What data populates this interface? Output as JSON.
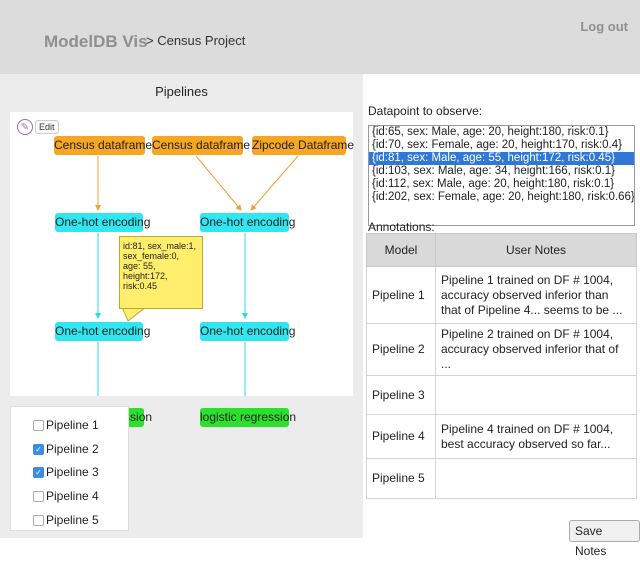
{
  "header": {
    "brand": "ModelDB Vis",
    "breadcrumb": "> Census Project",
    "logout": "Log out"
  },
  "left": {
    "title": "Pipelines",
    "edit_label": "Edit",
    "nodes": {
      "p1_source": "Census dataframe",
      "p2_source_a": "Census dataframe",
      "p2_source_b": "Zipcode Dataframe",
      "p1_enc1": "One-hot encoding",
      "p2_enc1": "One-hot encoding",
      "p1_enc2": "One-hot encoding",
      "p2_enc2": "One-hot encoding",
      "p1_lr": "logistic regression",
      "p2_lr": "logistic regression"
    },
    "tooltip_lines": [
      "id:81, sex_male:1,",
      "sex_female:0,",
      "age: 55, height:172,",
      "risk:0.45"
    ],
    "pipelines": [
      {
        "label": "Pipeline 1",
        "checked": false
      },
      {
        "label": "Pipeline 2",
        "checked": true
      },
      {
        "label": "Pipeline 3",
        "checked": true
      },
      {
        "label": "Pipeline 4",
        "checked": false
      },
      {
        "label": "Pipeline 5",
        "checked": false
      }
    ]
  },
  "colors": {
    "source_node": "#f5a623",
    "encoding_node": "#30e6f0",
    "model_node": "#2ce12c",
    "tooltip": "#ffee6b",
    "selection": "#2f78d8"
  },
  "datapoints": {
    "label": "Datapoint to observe:",
    "options": [
      "{id:65, sex: Male, age: 20, height:180, risk:0.1}",
      "{id:70, sex: Female, age: 20, height:170, risk:0.4}",
      "{id:81, sex: Male, age: 55, height:172, risk:0.45}",
      "{id:103, sex: Male, age: 34, height:166, risk:0.1}",
      "{id:112, sex: Male, age: 20, height:180, risk:0.1}",
      "{id:202, sex: Female, age: 20, height:180, risk:0.66}"
    ],
    "selected_index": 2
  },
  "annotations": {
    "label": "Annotations:",
    "headers": [
      "Model",
      "User Notes"
    ],
    "rows": [
      {
        "model": "Pipeline 1",
        "note": "Pipeline 1 trained on DF # 1004, accuracy observed inferior than that of Pipeline 4... seems to be ..."
      },
      {
        "model": "Pipeline 2",
        "note": "Pipeline 2 trained on DF # 1004, accuracy observed inferior that of ..."
      },
      {
        "model": "Pipeline 3",
        "note": ""
      },
      {
        "model": "Pipeline 4",
        "note": "Pipeline 4 trained on DF # 1004, best accuracy observed so far..."
      },
      {
        "model": "Pipeline 5",
        "note": ""
      }
    ],
    "save_label": "Save Notes"
  }
}
